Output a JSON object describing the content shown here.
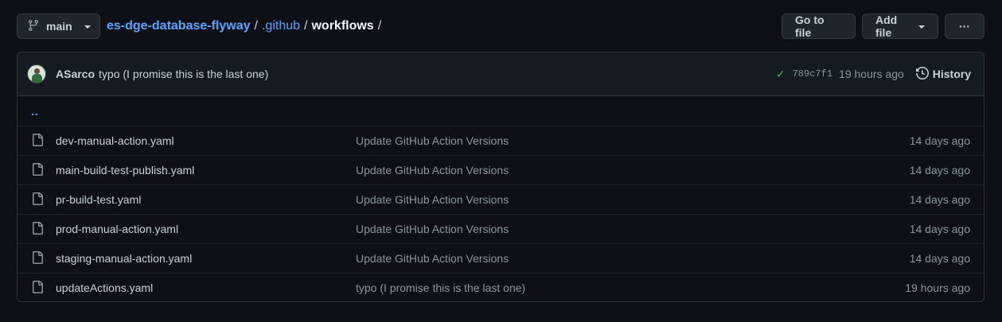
{
  "branch": {
    "name": "main"
  },
  "breadcrumb": {
    "repo": "es-dge-database-flyway",
    "sep1": "/",
    "dir": ".github",
    "sep2": "/",
    "current": "workflows",
    "sep3": "/"
  },
  "actions": {
    "go_to_file": "Go to file",
    "add_file": "Add file",
    "more": "···"
  },
  "latest_commit": {
    "author": "ASarco",
    "message": "typo (I promise this is the last one)",
    "status": "✓",
    "sha": "789c7f1",
    "time": "19 hours ago",
    "history_label": "History"
  },
  "parent_dir": "..",
  "files": [
    {
      "name": "dev-manual-action.yaml",
      "message": "Update GitHub Action Versions",
      "age": "14 days ago"
    },
    {
      "name": "main-build-test-publish.yaml",
      "message": "Update GitHub Action Versions",
      "age": "14 days ago"
    },
    {
      "name": "pr-build-test.yaml",
      "message": "Update GitHub Action Versions",
      "age": "14 days ago"
    },
    {
      "name": "prod-manual-action.yaml",
      "message": "Update GitHub Action Versions",
      "age": "14 days ago"
    },
    {
      "name": "staging-manual-action.yaml",
      "message": "Update GitHub Action Versions",
      "age": "14 days ago"
    },
    {
      "name": "updateActions.yaml",
      "message": "typo (I promise this is the last one)",
      "age": "19 hours ago"
    }
  ],
  "colors": {
    "background": "#0d1117",
    "link": "#58a6ff",
    "success": "#3fb950",
    "muted": "#8b949e"
  }
}
